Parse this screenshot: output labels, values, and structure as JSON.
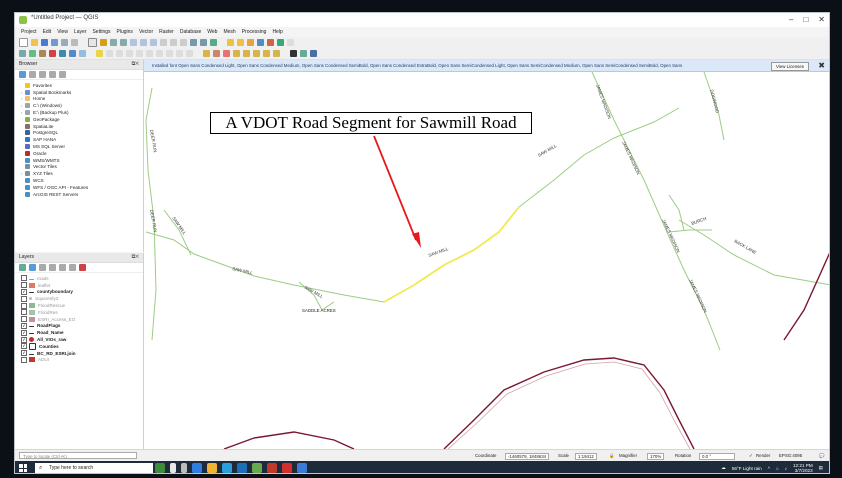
{
  "window": {
    "title": "*Untitled Project — QGIS",
    "controls": [
      "–",
      "□",
      "✕"
    ]
  },
  "menu": [
    "Project",
    "Edit",
    "View",
    "Layer",
    "Settings",
    "Plugins",
    "Vector",
    "Raster",
    "Database",
    "Web",
    "Mesh",
    "Processing",
    "Help"
  ],
  "colors": {
    "road_highlight": "#f3e94f",
    "road": "#9ccc83",
    "boundary": "#7a1830",
    "boundary_inner": "#d2a0a8"
  },
  "browser": {
    "title": "Browser",
    "items": [
      {
        "label": "Favorites",
        "icon": "star-icon"
      },
      {
        "label": "Spatial Bookmarks",
        "icon": "bookmark-icon"
      },
      {
        "label": "Home",
        "icon": "folder-icon"
      },
      {
        "label": "C:\\ (Windows)",
        "icon": "drive-icon"
      },
      {
        "label": "E:\\ (Backup Plus)",
        "icon": "drive-icon"
      },
      {
        "label": "GeoPackage",
        "icon": "geopackage-icon"
      },
      {
        "label": "SpatiaLite",
        "icon": "spatialite-icon"
      },
      {
        "label": "PostgreSQL",
        "icon": "postgresql-icon"
      },
      {
        "label": "SAP HANA",
        "icon": "database-icon"
      },
      {
        "label": "MS SQL Server",
        "icon": "database-icon"
      },
      {
        "label": "Oracle",
        "icon": "database-icon"
      },
      {
        "label": "WMS/WMTS",
        "icon": "globe-icon"
      },
      {
        "label": "Vector Tiles",
        "icon": "tiles-icon"
      },
      {
        "label": "XYZ Tiles",
        "icon": "tiles-icon"
      },
      {
        "label": "WCS",
        "icon": "globe-icon"
      },
      {
        "label": "WFS / OGC API - Features",
        "icon": "globe-icon"
      },
      {
        "label": "ArcGIS REST Servers",
        "icon": "globe-icon"
      }
    ]
  },
  "layers": {
    "title": "Layers",
    "items": [
      {
        "label": "roads",
        "checked": false,
        "style": "dim"
      },
      {
        "label": "leaflet",
        "checked": false,
        "style": "dim",
        "swatch": "#e07a5f"
      },
      {
        "label": "countyboundary",
        "checked": true,
        "style": "bold"
      },
      {
        "label": "Squaresfy3",
        "checked": false,
        "style": "dim"
      },
      {
        "label": "FloodRescue",
        "checked": false,
        "style": "dim",
        "swatch": "#8fb996"
      },
      {
        "label": "FloodRes",
        "checked": false,
        "style": "dim",
        "swatch": "#a3c4a8"
      },
      {
        "label": "ESRI_Access_EO",
        "checked": false,
        "style": "dim",
        "swatch": "#c98da3"
      },
      {
        "label": "RoadFlags",
        "checked": true,
        "style": "bold"
      },
      {
        "label": "Road_Name",
        "checked": true,
        "style": "bold"
      },
      {
        "label": "All_VIOs_raw",
        "checked": true,
        "style": "bold",
        "swatch": "#d62828"
      },
      {
        "label": "Counties",
        "checked": true,
        "style": "bold"
      },
      {
        "label": "BC_RD_ESRI.join",
        "checked": true,
        "style": "bold"
      },
      {
        "label": "ADUI",
        "checked": false,
        "style": "dim",
        "swatch": "#c0392b"
      }
    ]
  },
  "message_bar": {
    "text": "Installed font Open Sans Condensed Light, Open Sans Condensed Medium, Open Sans Condensed SemiBold, Open Sans Condensed ExtraBold, Open Sans SemiCondensed Light, Open Sans SemiCondensed Medium, Open Sans SemiCondensed SemiBold, Open Sans",
    "button": "View Licenses"
  },
  "annotation": {
    "text": "A VDOT Road Segment for Sawmill Road"
  },
  "map_labels": {
    "saw_mill_1": "SAW MILL",
    "saw_mill_2": "SAW MILL",
    "saw_mill_3": "SAW MILL",
    "saw_mill_4": "SAW MILL",
    "saw_mill_5": "SAW MILL",
    "james_madison_1": "JAMES MADISON",
    "james_madison_2": "JAMES MADISON",
    "james_madison_3": "JAMES MADISON",
    "james_madison_4": "JAMES MADISON",
    "saddle_acres": "SADDLE ACRES",
    "deer_run": "DEER RUN",
    "dogwood": "DOGWOOD",
    "back_lane": "BACK LANE",
    "burch": "BURCH"
  },
  "status": {
    "locator_placeholder": "Type to locate (Ctrl+K)",
    "coordinate_label": "Coordinate",
    "coordinate": "-1460579, 1848634",
    "scale_label": "Scale",
    "scale": "1:19412",
    "magnifier_label": "Magnifier",
    "magnifier": "170%",
    "rotation_label": "Rotation",
    "rotation": "0.0 °",
    "render_label": "Render",
    "crs": "EPSG:4095"
  },
  "taskbar": {
    "search_placeholder": "Type here to search",
    "weather": "56°F Light rain",
    "time": "12:21 PM",
    "date": "3/7/2023"
  }
}
